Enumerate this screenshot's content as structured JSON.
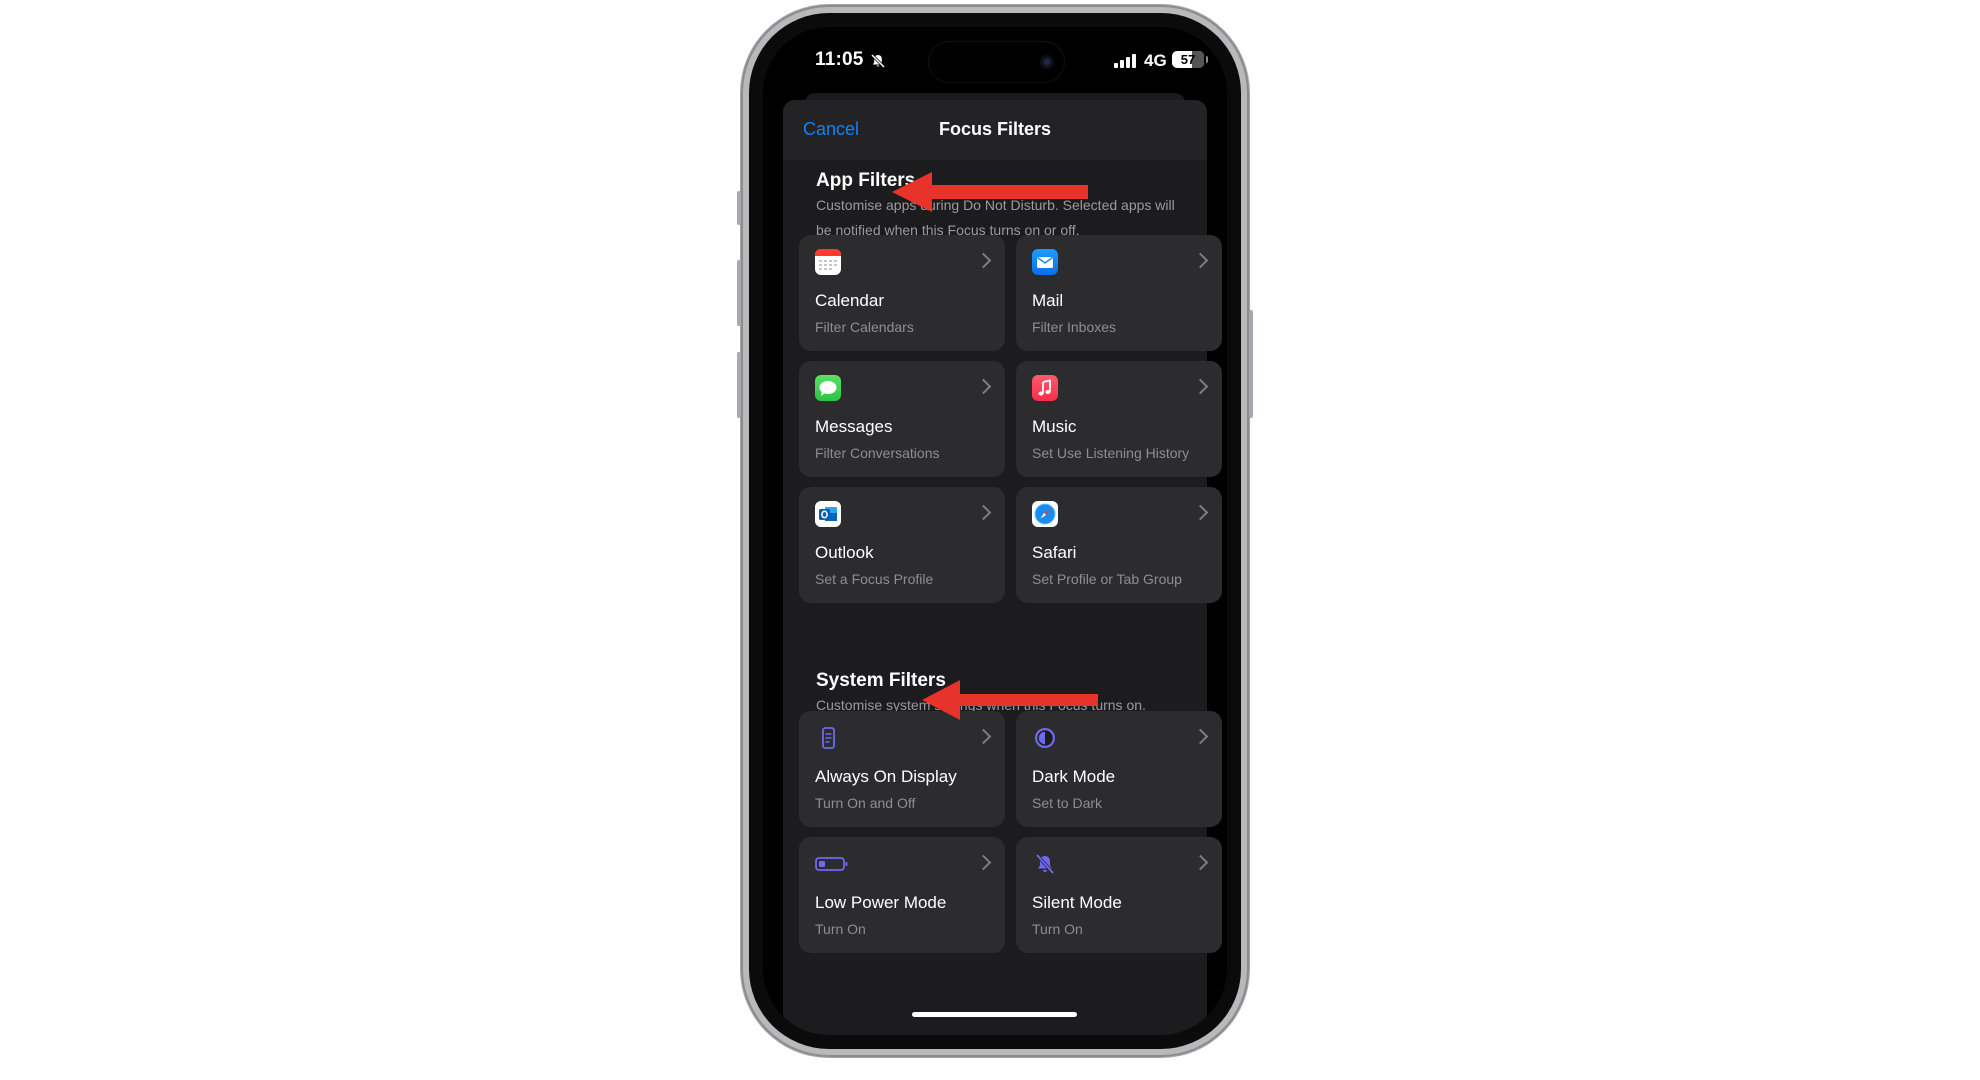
{
  "status_bar": {
    "time": "11:05",
    "network": "4G",
    "battery": "57"
  },
  "nav": {
    "cancel_label": "Cancel",
    "title": "Focus Filters"
  },
  "app_filters": {
    "title": "App Filters",
    "description": "Customise apps during Do Not Disturb. Selected apps will be notified when this Focus turns on or off.",
    "items": [
      {
        "name": "Calendar",
        "sub": "Filter Calendars",
        "icon": "calendar-icon"
      },
      {
        "name": "Mail",
        "sub": "Filter Inboxes",
        "icon": "mail-icon"
      },
      {
        "name": "Messages",
        "sub": "Filter Conversations",
        "icon": "messages-icon"
      },
      {
        "name": "Music",
        "sub": "Set Use Listening History",
        "icon": "music-icon"
      },
      {
        "name": "Outlook",
        "sub": "Set a Focus Profile",
        "icon": "outlook-icon"
      },
      {
        "name": "Safari",
        "sub": "Set Profile or Tab Group",
        "icon": "safari-icon"
      }
    ]
  },
  "system_filters": {
    "title": "System Filters",
    "description": "Customise system settings when this Focus turns on.",
    "items": [
      {
        "name": "Always On Display",
        "sub": "Turn On and Off",
        "icon": "always-on-display-icon"
      },
      {
        "name": "Dark Mode",
        "sub": "Set to Dark",
        "icon": "dark-mode-icon"
      },
      {
        "name": "Low Power Mode",
        "sub": "Turn On",
        "icon": "low-power-icon"
      },
      {
        "name": "Silent Mode",
        "sub": "Turn On",
        "icon": "silent-mode-icon"
      }
    ]
  },
  "colors": {
    "accent": "#0a84ff",
    "annotation_arrow": "#e8332a",
    "card": "#2c2c2e",
    "sheet": "#1c1c1e",
    "system_icon": "#5e5ce6"
  }
}
